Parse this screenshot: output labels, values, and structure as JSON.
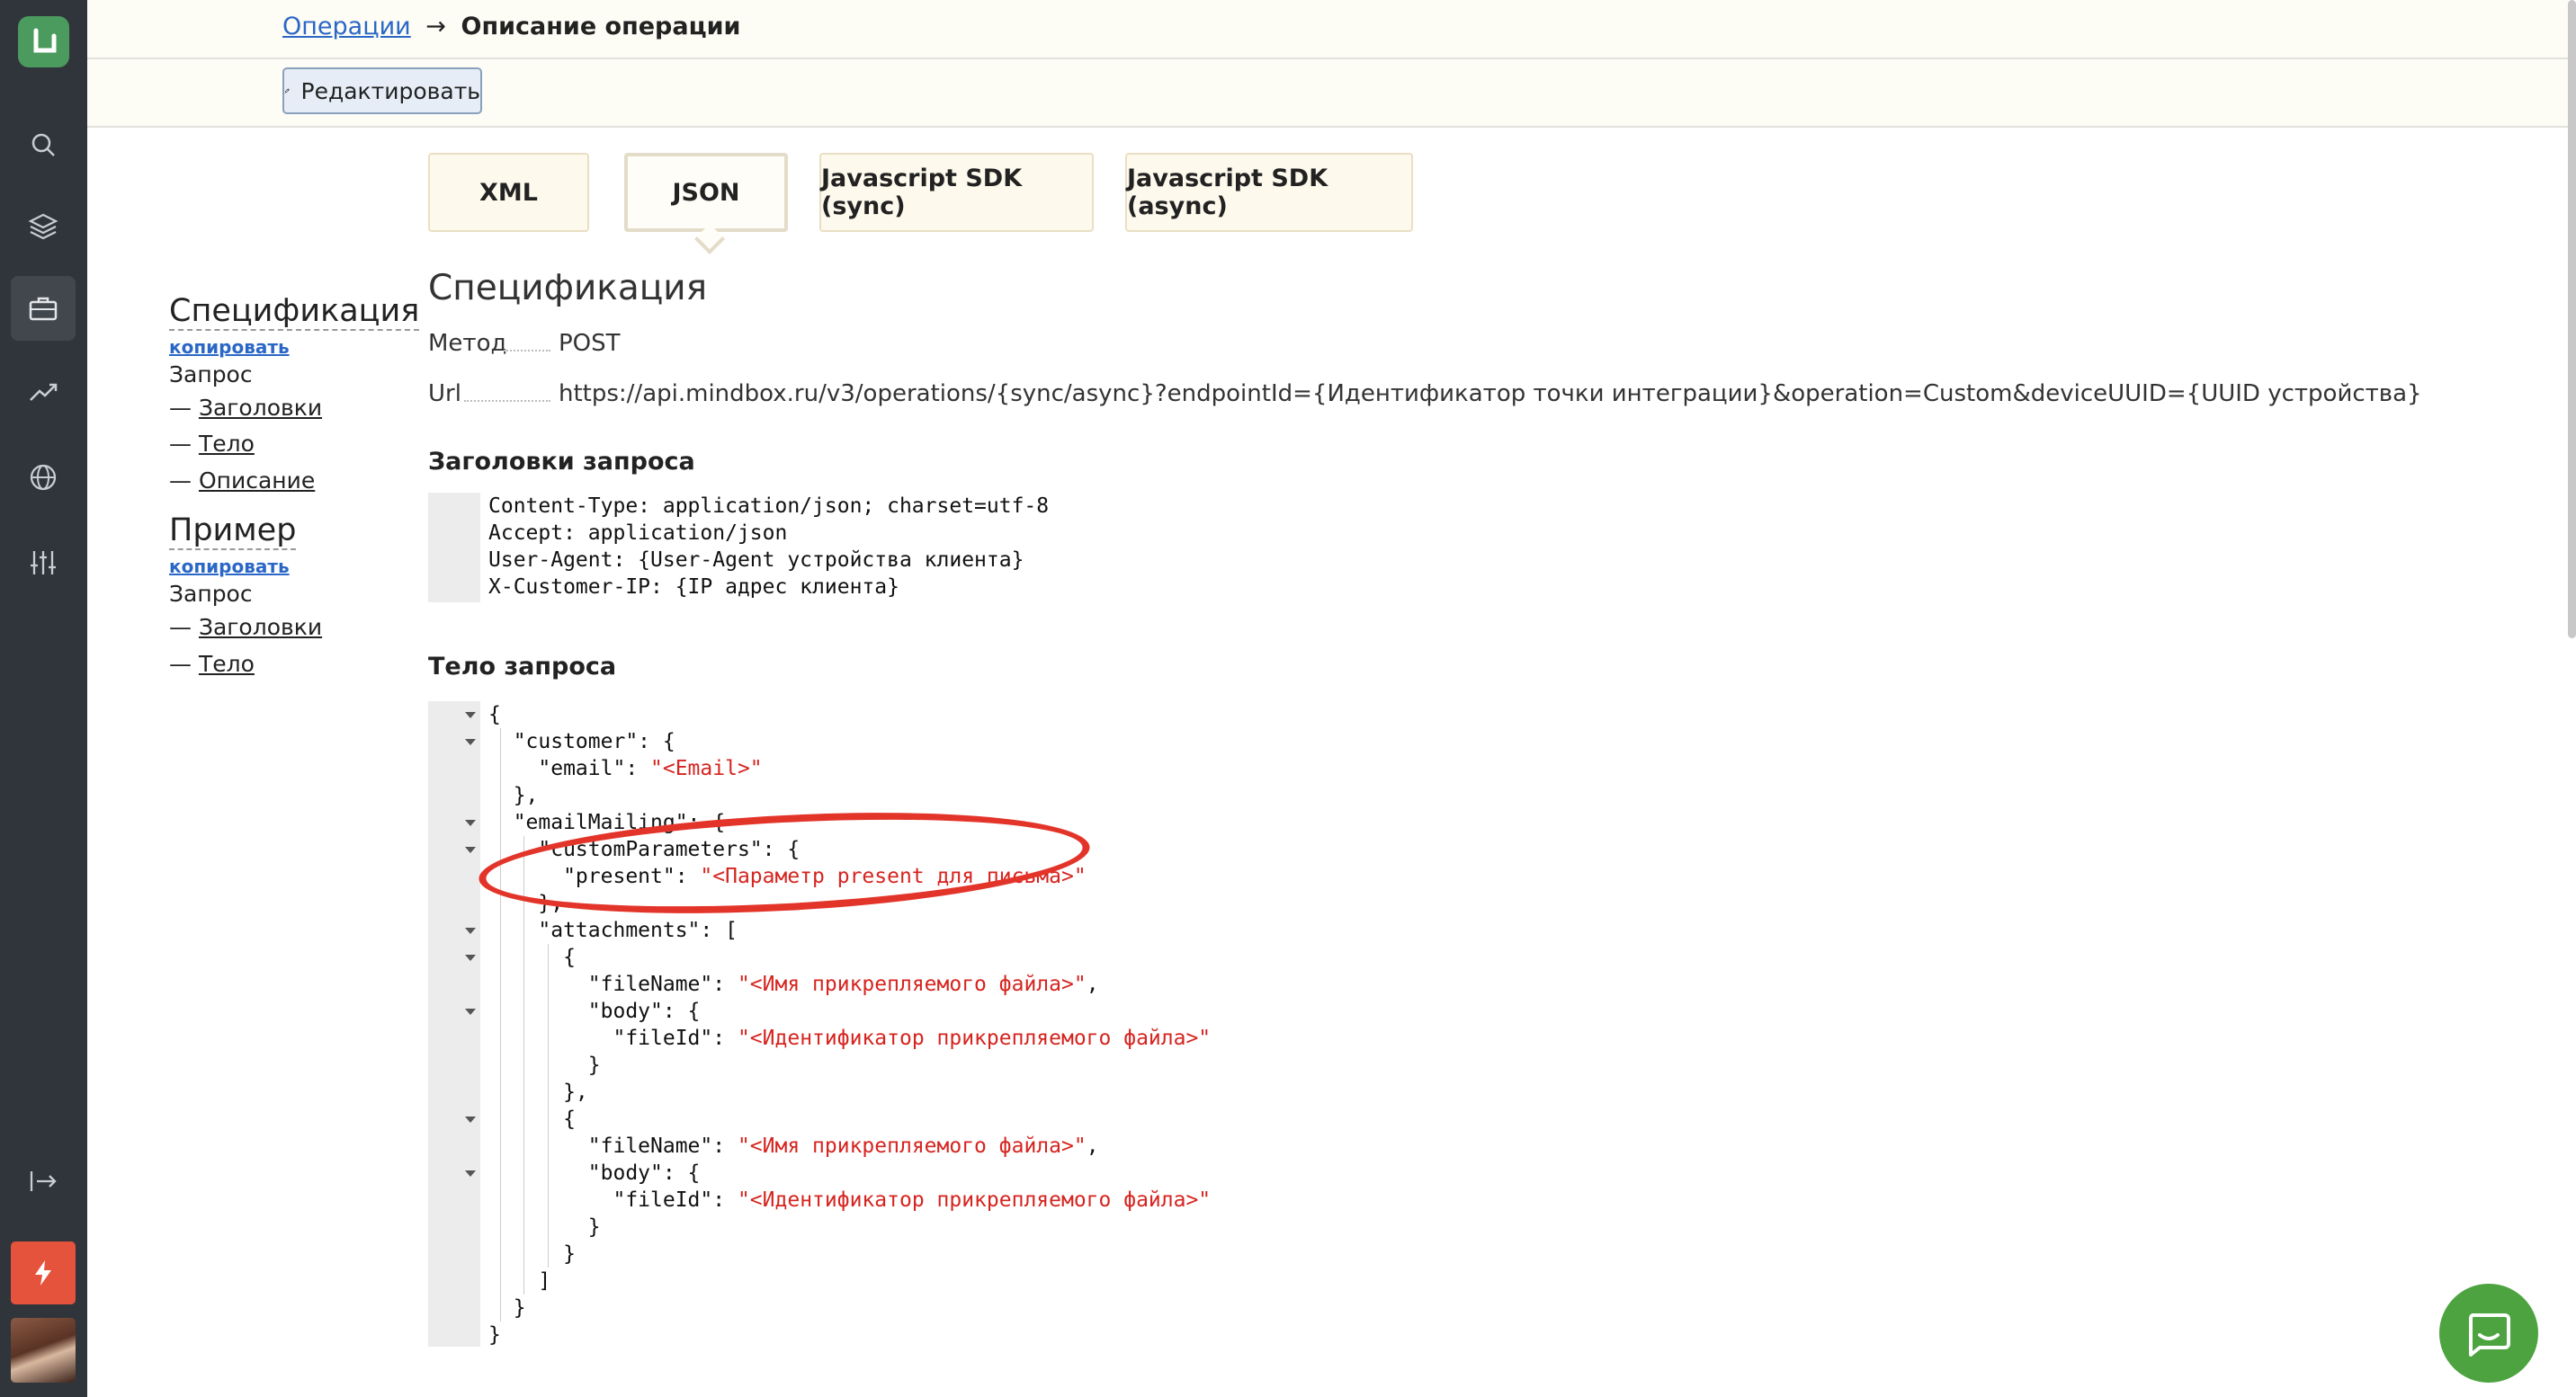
{
  "breadcrumb": {
    "parent": "Операции",
    "arrow": "→",
    "current": "Описание операции"
  },
  "toolbar": {
    "edit_label": "Редактировать"
  },
  "tabs": [
    "XML",
    "JSON",
    "Javascript SDK (sync)",
    "Javascript SDK (async)"
  ],
  "active_tab": "JSON",
  "toc": {
    "spec_title": "Спецификация",
    "spec_copy": "копировать",
    "spec_request": "Запрос",
    "spec_headers": "Заголовки",
    "spec_body": "Тело",
    "spec_description": "Описание",
    "example_title": "Пример",
    "example_copy": "копировать",
    "example_request": "Запрос",
    "example_headers": "Заголовки",
    "example_body": "Тело",
    "dash": "—"
  },
  "spec": {
    "title": "Спецификация",
    "method_label": "Метод",
    "method_value": "POST",
    "url_label": "Url",
    "url_value": "https://api.mindbox.ru/v3/operations/{sync/async}?endpointId={Идентификатор точки интеграции}&operation=Custom&deviceUUID={UUID устройства}"
  },
  "headers_section": {
    "title": "Заголовки запроса",
    "lines": [
      "Content-Type: application/json; charset=utf-8",
      "Accept: application/json",
      "User-Agent: {User-Agent устройства клиента}",
      "X-Customer-IP: {IP адрес клиента}"
    ]
  },
  "body_section": {
    "title": "Тело запроса",
    "code": {
      "l1": "{",
      "l2k": "  \"customer\": {",
      "l3k": "    \"email\": ",
      "l3v": "\"<Email>\"",
      "l4": "  },",
      "l5k": "  \"emailMailing\": {",
      "l6k": "    \"customParameters\": {",
      "l7k": "      \"present\": ",
      "l7v": "\"<Параметр present для письма>\"",
      "l8": "    },",
      "l9k": "    \"attachments\": [",
      "l10": "      {",
      "l11k": "        \"fileName\": ",
      "l11v": "\"<Имя прикрепляемого файла>\"",
      "l11e": ",",
      "l12k": "        \"body\": {",
      "l13k": "          \"fileId\": ",
      "l13v": "\"<Идентификатор прикрепляемого файла>\"",
      "l14": "        }",
      "l15": "      },",
      "l16": "      {",
      "l17k": "        \"fileName\": ",
      "l17v": "\"<Имя прикрепляемого файла>\"",
      "l17e": ",",
      "l18k": "        \"body\": {",
      "l19k": "          \"fileId\": ",
      "l19v": "\"<Идентификатор прикрепляемого файла>\"",
      "l20": "        }",
      "l21": "      }",
      "l22": "    ]",
      "l23": "  }",
      "l24": "}"
    }
  },
  "colors": {
    "sidebar": "#30343b",
    "logo": "#4b9a5e",
    "accent_link": "#2b67c6",
    "string": "#d6241f",
    "annotation": "#e3342a",
    "chat": "#4ca33f",
    "bolt": "#e5533c"
  },
  "icons": [
    "logo-icon",
    "search-icon",
    "layers-icon",
    "briefcase-icon",
    "trend-icon",
    "globe-icon",
    "sliders-icon",
    "collapse-icon",
    "bolt-icon",
    "pencil-icon",
    "chat-icon"
  ]
}
